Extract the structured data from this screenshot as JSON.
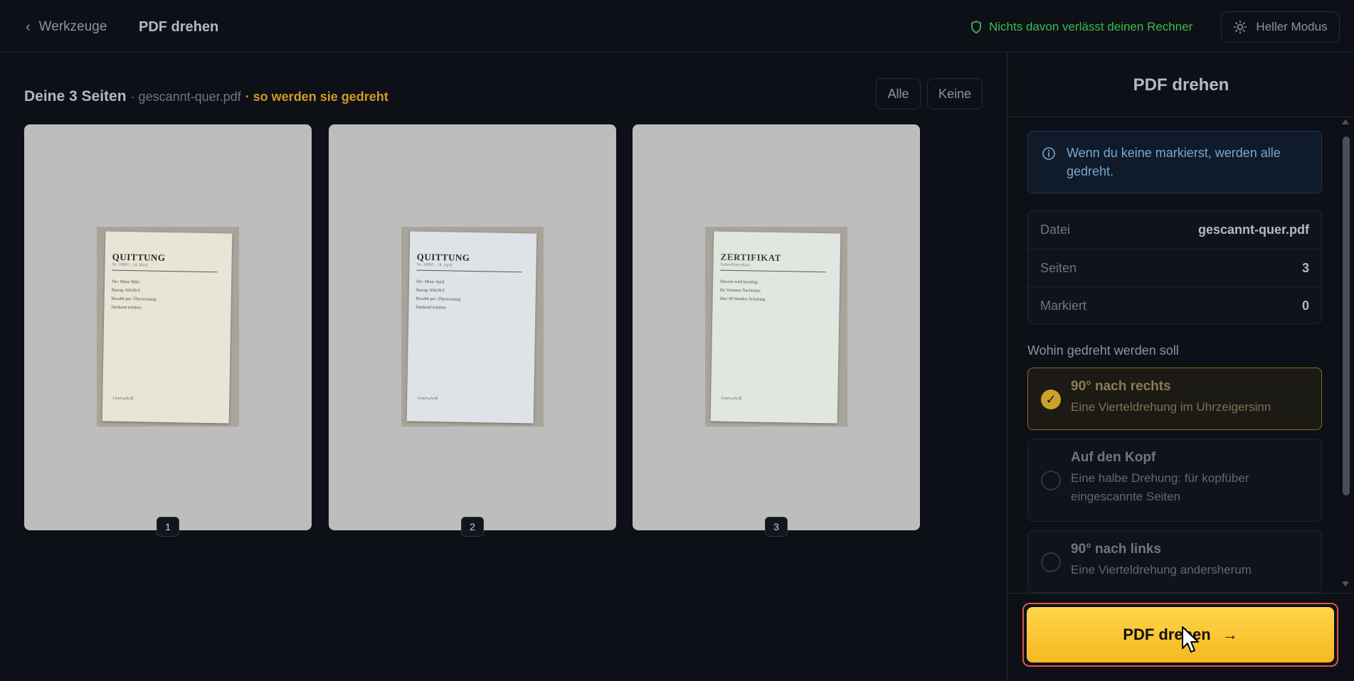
{
  "topbar": {
    "back_label": "Werkzeuge",
    "title": "PDF drehen",
    "privacy_text": "Nichts davon verlässt deinen Rechner",
    "mode_label": "Heller Modus"
  },
  "pages": {
    "heading_strong": "Deine 3 Seiten",
    "heading_file": "· gescannt-quer.pdf",
    "heading_accent": "· so werden sie gedreht",
    "select_all": "Alle",
    "select_none": "Keine",
    "items": [
      {
        "number": "1",
        "doc_title": "QUITTUNG",
        "doc_sub": "Nr. 10001 · 14. März",
        "lines": [
          "Für: Miete März",
          "Betrag: 650,00 €",
          "Bezahlt per: Überweisung",
          "Dankend erhalten"
        ],
        "sign": "Unterschrift",
        "paper_color": "#e8e4d6"
      },
      {
        "number": "2",
        "doc_title": "QUITTUNG",
        "doc_sub": "Nr. 10002 · 14. April",
        "lines": [
          "Für: Miete April",
          "Betrag: 650,00 €",
          "Bezahlt per: Überweisung",
          "Dankend erhalten"
        ],
        "sign": "Unterschrift",
        "paper_color": "#dfe3e8"
      },
      {
        "number": "3",
        "doc_title": "ZERTIFIKAT",
        "doc_sub": "Schnellkurs-Kurs",
        "lines": [
          "Hiermit wird bestätigt",
          "für Vorname Nachname",
          "über 40 Stunden Schulung"
        ],
        "sign": "Unterschrift",
        "paper_color": "#e2e6e0"
      }
    ]
  },
  "panel": {
    "title": "PDF drehen",
    "info_text": "Wenn du keine markierst, werden alle gedreht.",
    "stats": [
      {
        "label": "Datei",
        "value": "gescannt-quer.pdf"
      },
      {
        "label": "Seiten",
        "value": "3"
      },
      {
        "label": "Markiert",
        "value": "0"
      }
    ],
    "section_label": "Wohin gedreht werden soll",
    "options": [
      {
        "title": "90° nach rechts",
        "desc": "Eine Vierteldrehung im Uhrzeigersinn",
        "selected": true
      },
      {
        "title": "Auf den Kopf",
        "desc": "Eine halbe Drehung: für kopfüber eingescannte Seiten",
        "selected": false
      },
      {
        "title": "90° nach links",
        "desc": "Eine Vierteldrehung andersherum",
        "selected": false
      }
    ],
    "cta_label": "PDF drehen",
    "cta_arrow": "→"
  },
  "colors": {
    "accent": "#f6b820",
    "privacy_green": "#3fb950",
    "heading_accent": "#d29922",
    "highlight_red": "#e5534b"
  },
  "icons": [
    "chevron-left-icon",
    "shield-icon",
    "sun-icon",
    "info-icon",
    "check-icon",
    "arrow-right-icon",
    "cursor-icon"
  ]
}
